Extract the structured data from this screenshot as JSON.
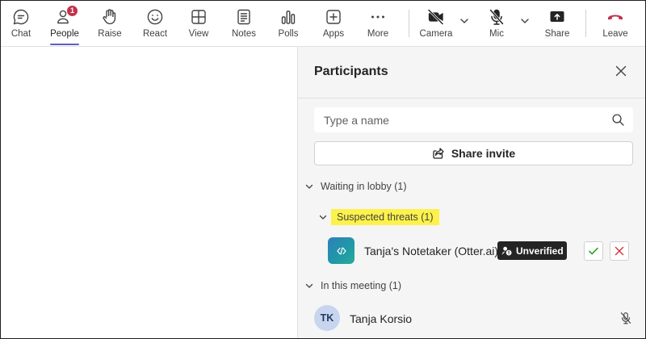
{
  "toolbar": {
    "chat_label": "Chat",
    "people_label": "People",
    "people_badge": "1",
    "raise_label": "Raise",
    "react_label": "React",
    "view_label": "View",
    "notes_label": "Notes",
    "polls_label": "Polls",
    "apps_label": "Apps",
    "more_label": "More",
    "camera_label": "Camera",
    "mic_label": "Mic",
    "share_label": "Share",
    "leave_label": "Leave"
  },
  "panel": {
    "title": "Participants",
    "search_placeholder": "Type a name",
    "share_invite_label": "Share invite",
    "waiting_section": "Waiting in lobby (1)",
    "threats_section": "Suspected threats (1)",
    "lobby_participant_name": "Tanja's Notetaker (Otter.ai)",
    "unverified_label": "Unverified",
    "meeting_section": "In this meeting (1)",
    "meeting_participant_initials": "TK",
    "meeting_participant_name": "Tanja Korsio"
  },
  "colors": {
    "accent": "#5b5fc7",
    "badge": "#c4314b",
    "leave": "#c4314b",
    "threat_highlight": "#fdf24b",
    "admit": "#13a10e",
    "deny": "#d13438"
  }
}
